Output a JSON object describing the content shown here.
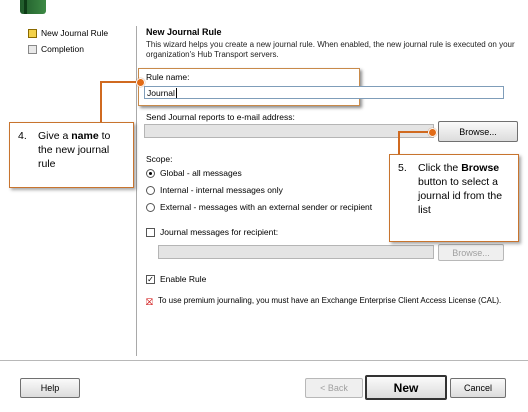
{
  "nav": [
    {
      "label": "New Journal Rule",
      "active": true
    },
    {
      "label": "Completion",
      "active": false
    }
  ],
  "header": {
    "title": "New Journal Rule",
    "description": "This wizard helps you create a new journal rule. When enabled, the new journal rule is executed on your organization's Hub Transport servers."
  },
  "form": {
    "rule_name_label": "Rule name:",
    "rule_name_value": "Journal",
    "send_reports_label": "Send Journal reports to e-mail address:",
    "send_reports_value": "",
    "browse_label": "Browse...",
    "scope_label": "Scope:",
    "scope_options": [
      {
        "label": "Global - all messages",
        "selected": true
      },
      {
        "label": "Internal - internal messages only",
        "selected": false
      },
      {
        "label": "External - messages with an external sender or recipient",
        "selected": false
      }
    ],
    "journal_recipient_label": "Journal messages for recipient:",
    "journal_recipient_checked": false,
    "recipient_value": "",
    "browse2_label": "Browse...",
    "enable_rule_label": "Enable Rule",
    "enable_rule_checked": true,
    "premium_note": "To use premium journaling, you must have an Exchange Enterprise Client Access License (CAL)."
  },
  "footer": {
    "help_label": "Help",
    "back_label": "< Back",
    "new_label": "New",
    "cancel_label": "Cancel"
  },
  "callouts": {
    "c4_num": "4.",
    "c4_pre": "Give  a ",
    "c4_bold": "name",
    "c4_post": " to the new journal rule",
    "c5_num": "5.",
    "c5_pre": "Click the ",
    "c5_bold": "Browse",
    "c5_post": " button to select a journal id from the list"
  },
  "colors": {
    "callout_border": "#c8742e",
    "connector": "#d06a20",
    "active_nav": "#f3d14a"
  }
}
